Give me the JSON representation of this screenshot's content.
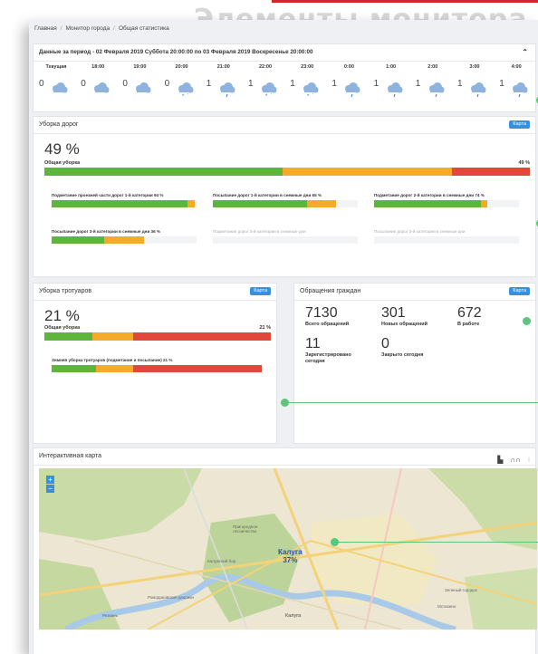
{
  "watermark": "Элементы монитора",
  "breadcrumb": [
    "Главная",
    "Монитор города",
    "Общая статистика"
  ],
  "period": {
    "text": "Данные за период - 02 Февраля 2019 Суббота 20:00:00 по 03 Февраля 2019 Воскресенье 20:00:00"
  },
  "forecast": [
    {
      "time": "Текущая",
      "value": "0",
      "icon": "cloud-icon"
    },
    {
      "time": "18:00",
      "value": "0",
      "icon": "cloud-icon"
    },
    {
      "time": "19:00",
      "value": "0",
      "icon": "cloud-icon"
    },
    {
      "time": "20:00",
      "value": "0",
      "icon": "snow-cloud-icon"
    },
    {
      "time": "21:00",
      "value": "1",
      "icon": "rain-cloud-icon"
    },
    {
      "time": "22:00",
      "value": "1",
      "icon": "snow-cloud-icon"
    },
    {
      "time": "23:00",
      "value": "1",
      "icon": "snow-cloud-icon"
    },
    {
      "time": "0:00",
      "value": "1",
      "icon": "rain-cloud-icon"
    },
    {
      "time": "1:00",
      "value": "1",
      "icon": "rain-cloud-icon"
    },
    {
      "time": "2:00",
      "value": "1",
      "icon": "rain-cloud-icon"
    },
    {
      "time": "3:00",
      "value": "1",
      "icon": "rain-cloud-icon"
    },
    {
      "time": "4:00",
      "value": "1",
      "icon": "rain-cloud-icon"
    }
  ],
  "roads": {
    "title": "Уборка дорог",
    "map_button": "Карта",
    "percent": "49 %",
    "label": "Общая уборка",
    "bar_label": "49 %",
    "bar": [
      0.49,
      0.35,
      0.16
    ],
    "sub": [
      {
        "label": "Подметание проезжей части дорог 1-й категории 94 %",
        "bar": [
          0.94,
          0.05,
          0.0
        ]
      },
      {
        "label": "Посыпание дорог 1-й категории в снежные дни 65 %",
        "bar": [
          0.65,
          0.2,
          0.0
        ]
      },
      {
        "label": "Подметание дорог 2-й категории в снежные дни 74 %",
        "bar": [
          0.74,
          0.04,
          0.0
        ]
      },
      {
        "label": "Посыпание дорог 3-й категории в снежные дни 36 %",
        "bar": [
          0.36,
          0.28,
          0.0
        ]
      },
      {
        "label": "Подметание дорог 3-й категории в снежные дни",
        "bar": [
          0,
          0,
          0
        ]
      },
      {
        "label": "Посыпание дорог 3-й категории в снежные дни",
        "bar": [
          0,
          0,
          0
        ]
      }
    ]
  },
  "sidewalks": {
    "title": "Уборка тротуаров",
    "map_button": "Карта",
    "percent": "21 %",
    "label": "Общая уборка",
    "bar_label": "21 %",
    "bar": [
      0.21,
      0.18,
      0.61
    ],
    "sub": {
      "label": "Зимняя уборка тротуаров (подметание и посыпание) 21 %",
      "bar": [
        0.21,
        0.18,
        0.61
      ]
    }
  },
  "appeals": {
    "title": "Обращения граждан",
    "map_button": "Карта",
    "stats": [
      {
        "value": "7130",
        "label": "Всего обращений"
      },
      {
        "value": "301",
        "label": "Новых обращений"
      },
      {
        "value": "672",
        "label": "В работе"
      },
      {
        "value": "11",
        "label": "Зарегистрировано сегодня"
      },
      {
        "value": "0",
        "label": "Закрыто сегодня"
      }
    ]
  },
  "map": {
    "title": "Интерактивная карта",
    "city_label": "Калуга",
    "city_percent": "37%",
    "city_name": "Калуга",
    "zoom_in": "+",
    "zoom_out": "−",
    "place_labels": [
      "Пригородное лесничество",
      "Калужский бор",
      "Ромодановские дворики",
      "Резвань",
      "Мстихино",
      "Зеленый городок"
    ]
  }
}
